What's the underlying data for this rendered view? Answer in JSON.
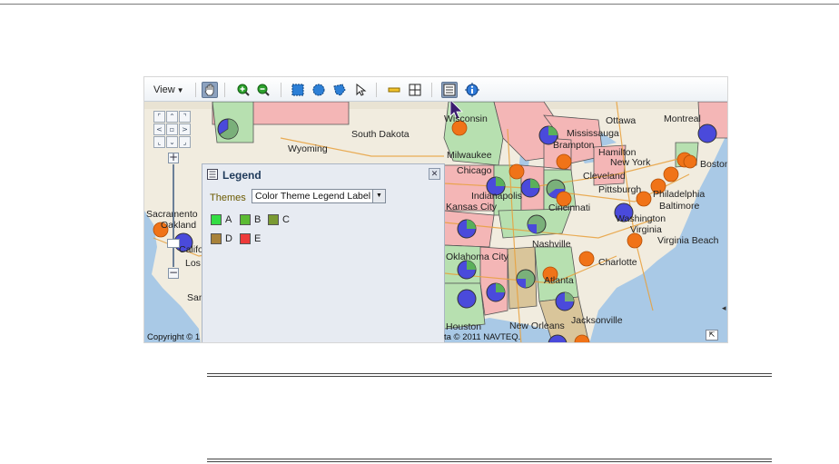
{
  "toolbar": {
    "view_label": "View",
    "buttons": [
      "pan-icon",
      "zoom-in-icon",
      "zoom-out-icon",
      "rectangle-select-icon",
      "circle-select-icon",
      "polygon-select-icon",
      "pointer-icon",
      "distance-ruler-icon",
      "grid-icon",
      "legend-icon",
      "info-icon"
    ]
  },
  "legend": {
    "title": "Legend",
    "themes_label": "Themes",
    "themes_selected": "Color Theme Legend Label",
    "items": [
      {
        "label": "A",
        "color": "#33dd44"
      },
      {
        "label": "B",
        "color": "#5cbb33"
      },
      {
        "label": "C",
        "color": "#7a9a33"
      },
      {
        "label": "D",
        "color": "#a8823a"
      },
      {
        "label": "E",
        "color": "#ee3a3a"
      }
    ]
  },
  "map": {
    "cities": [
      "Wisconsin",
      "South Dakota",
      "Wyoming",
      "Milwaukee",
      "Chicago",
      "Ottawa",
      "Montreal",
      "Mississauga",
      "Brampton",
      "Hamilton",
      "New York",
      "Cleveland",
      "Pittsburgh",
      "Philadelphia",
      "Baltimore",
      "Washington",
      "Cincinnati",
      "Indianapolis",
      "Kansas City",
      "Nashville",
      "Virginia",
      "Virginia Beach",
      "Charlotte",
      "Atlanta",
      "Oklahoma City",
      "New Orleans",
      "Jacksonville",
      "Houston",
      "Boston",
      "Sacramento",
      "Oakland",
      "San",
      "Los",
      "California"
    ],
    "copyright_left": "Copyright © 1",
    "copyright_right": "ta © 2011 NAVTEQ."
  }
}
